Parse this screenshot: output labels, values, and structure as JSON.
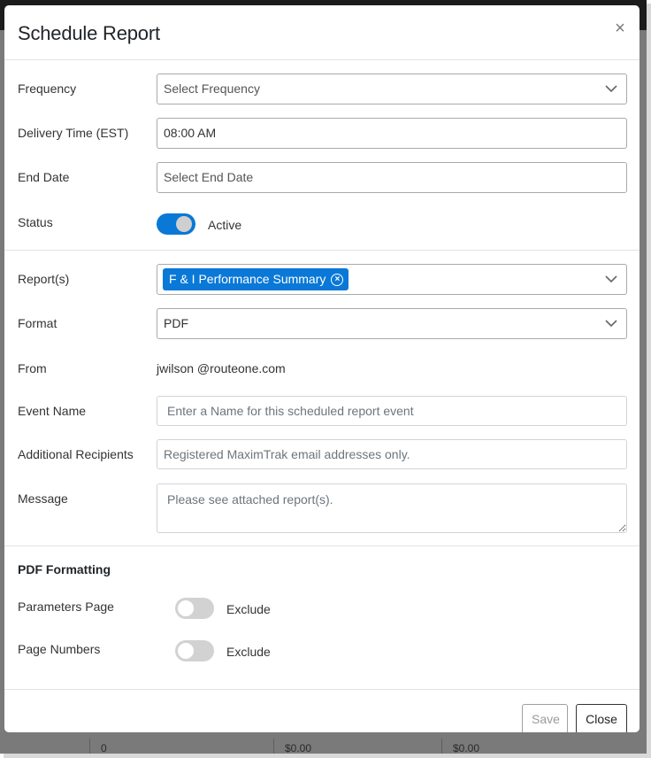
{
  "background": {
    "row_cells": [
      "0",
      "$0.00",
      "$0.00"
    ]
  },
  "modal": {
    "title": "Schedule Report",
    "close_icon": "close-x-icon"
  },
  "form": {
    "frequency": {
      "label": "Frequency",
      "placeholder": "Select Frequency",
      "icon": "chevron-down-icon"
    },
    "delivery_time": {
      "label": "Delivery Time (EST)",
      "value": "08:00 AM"
    },
    "end_date": {
      "label": "End Date",
      "placeholder": "Select End Date"
    },
    "status": {
      "label": "Status",
      "toggle_on": true,
      "toggle_text": "Active"
    },
    "reports": {
      "label": "Report(s)",
      "selected": [
        "F & I Performance Summary"
      ],
      "chip_remove_icon": "circle-x-icon",
      "icon": "chevron-down-icon"
    },
    "format": {
      "label": "Format",
      "value": "PDF",
      "icon": "chevron-down-icon"
    },
    "from": {
      "label": "From",
      "value": "jwilson @routeone.com"
    },
    "event_name": {
      "label": "Event Name",
      "placeholder": "Enter a Name for this scheduled report event"
    },
    "additional_recipients": {
      "label": "Additional Recipients",
      "placeholder": "Registered MaximTrak email addresses only."
    },
    "message": {
      "label": "Message",
      "placeholder": "Please see attached report(s)."
    }
  },
  "pdf_formatting": {
    "heading": "PDF Formatting",
    "parameters_page": {
      "label": "Parameters Page",
      "toggle_on": false,
      "toggle_text": "Exclude"
    },
    "page_numbers": {
      "label": "Page Numbers",
      "toggle_on": false,
      "toggle_text": "Exclude"
    }
  },
  "footer": {
    "save_label": "Save",
    "close_label": "Close"
  },
  "colors": {
    "accent": "#0a78d7",
    "toggle_off": "#d2d2d2"
  }
}
